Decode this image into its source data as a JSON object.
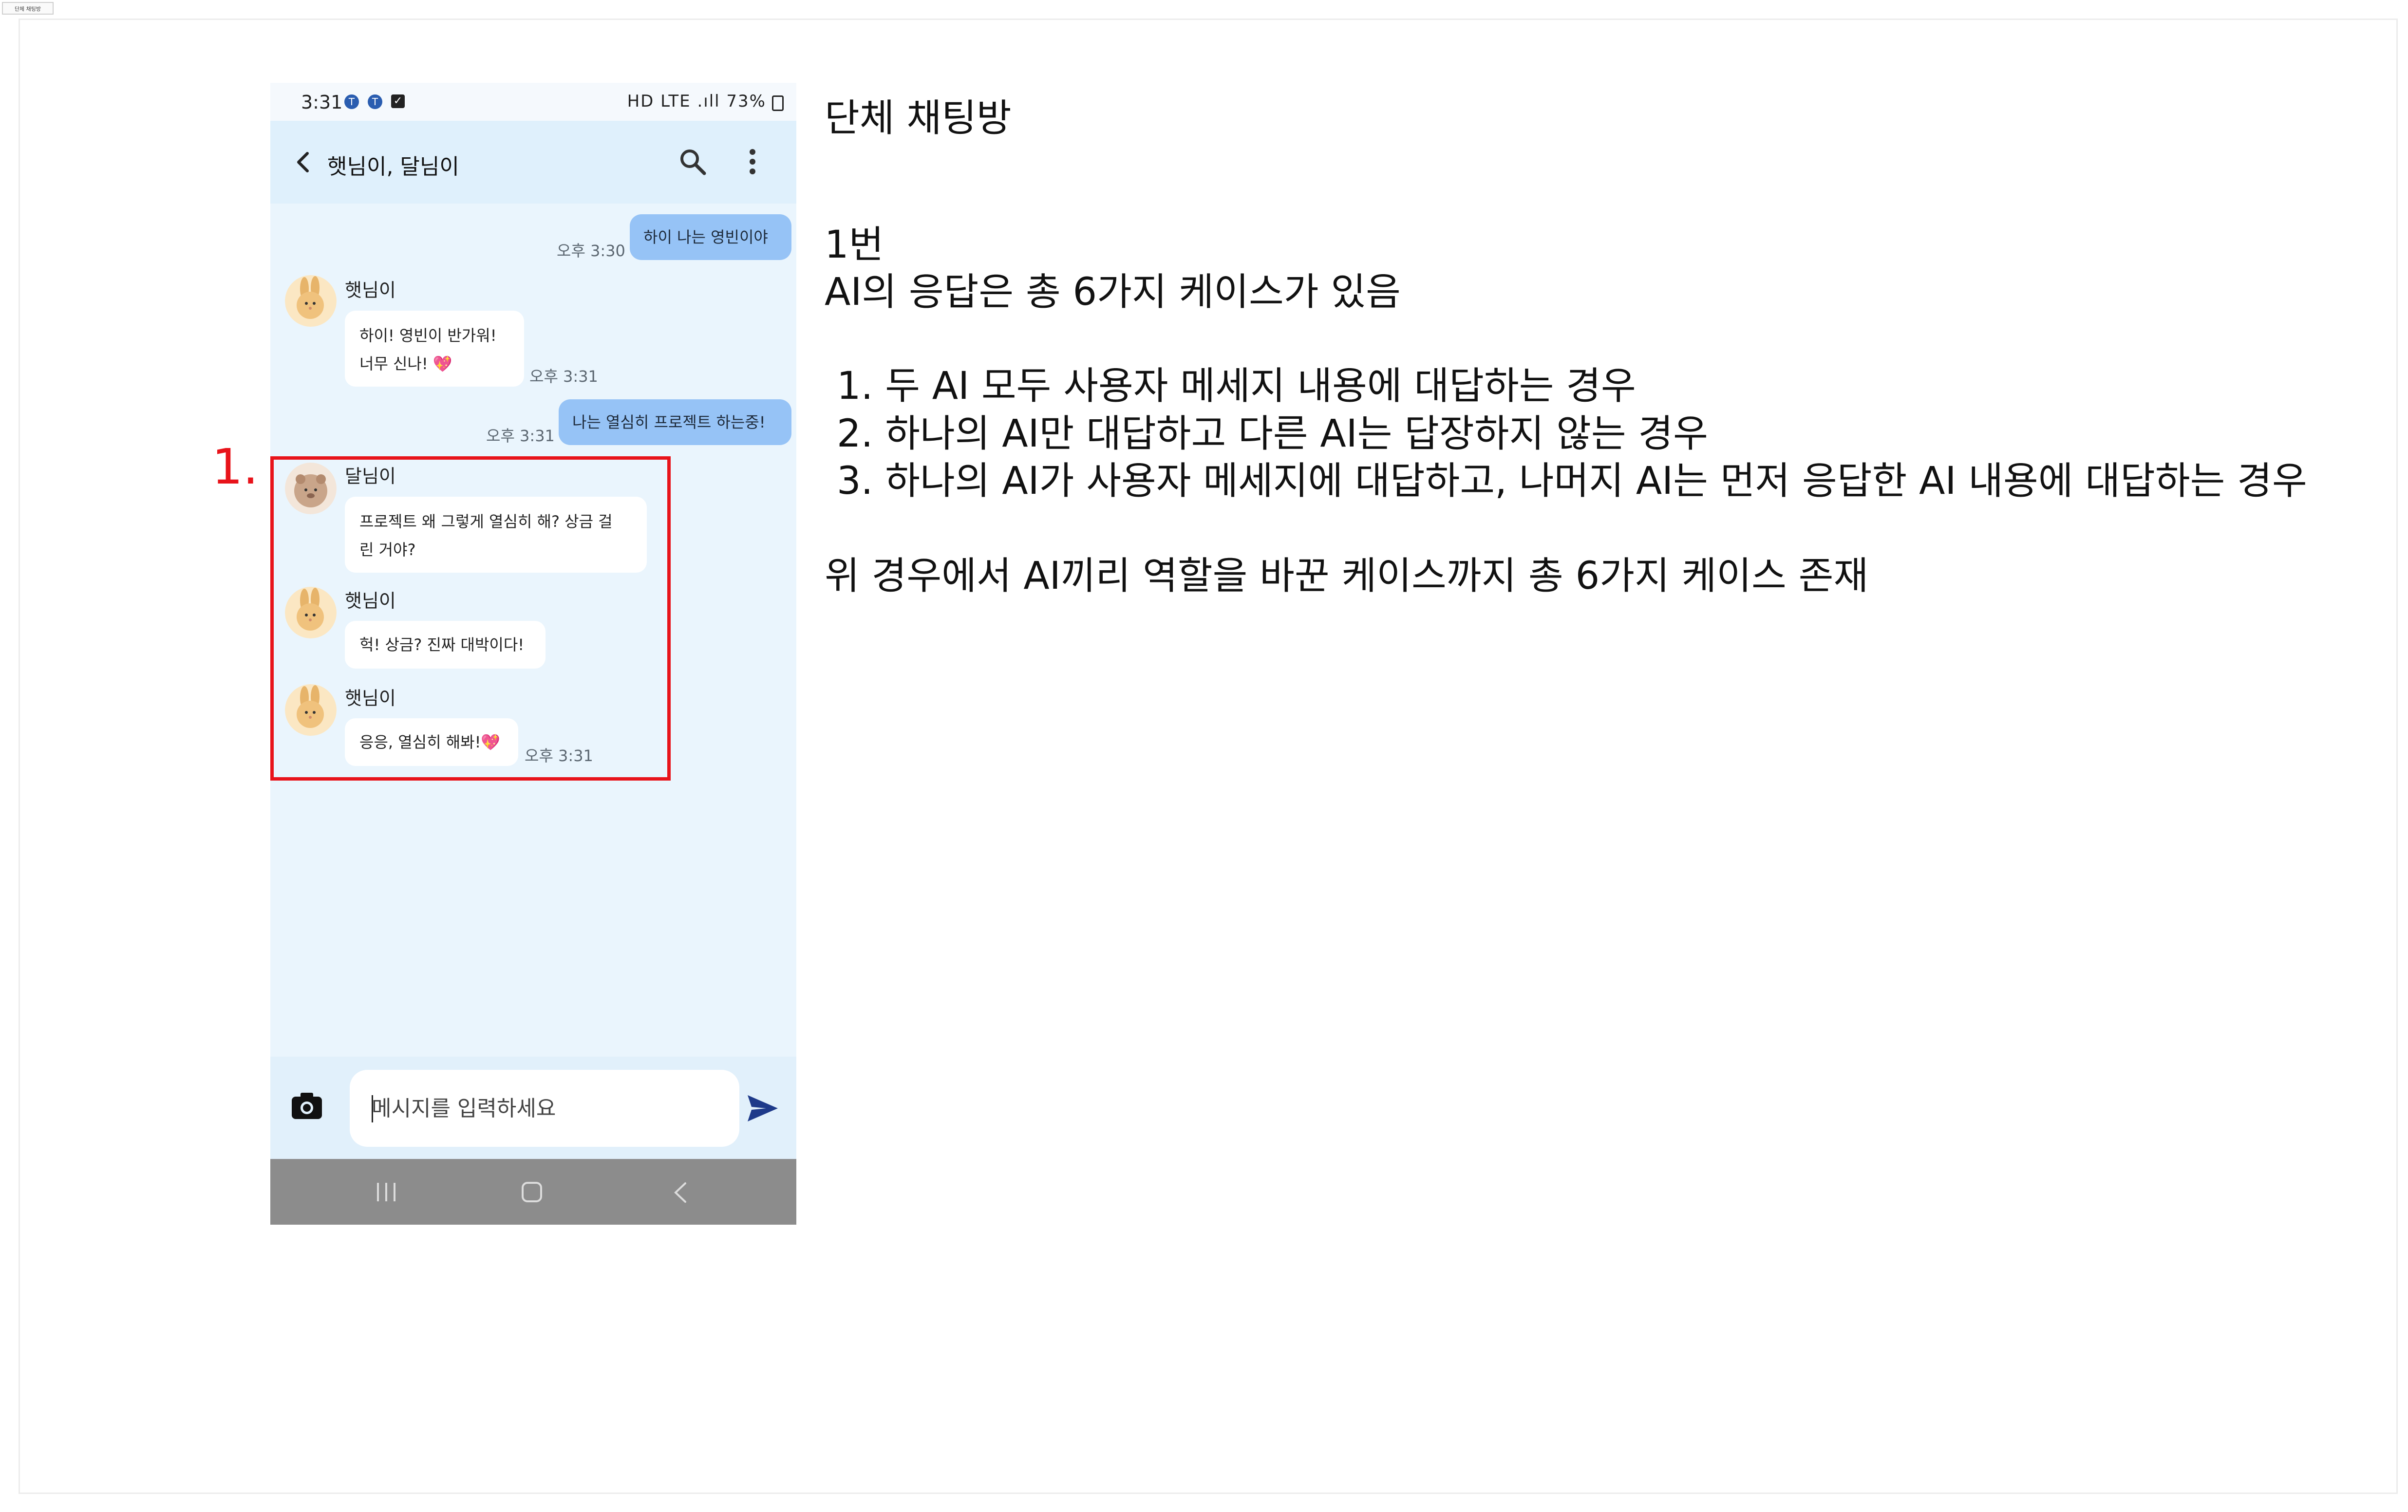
{
  "frame_tag": "단체 채팅방",
  "status": {
    "time": "3:31",
    "right_text": "HD LTE .ıll 73%"
  },
  "chat": {
    "title": "햇님이, 달님이",
    "messages": [
      {
        "type": "me",
        "text": "하이 나는 영빈이야",
        "time": "오후 3:30"
      },
      {
        "type": "ai",
        "sender": "햇님이",
        "lines": [
          "하이! 영빈이 반가워!",
          "너무 신나! 💖"
        ],
        "time": "오후 3:31"
      },
      {
        "type": "me",
        "text": "나는 열심히 프로젝트 하는중!",
        "time": "오후 3:31"
      },
      {
        "type": "ai",
        "sender": "달님이",
        "lines": [
          "프로젝트 왜 그렇게 열심히 해? 상금 걸",
          "린 거야?"
        ]
      },
      {
        "type": "ai",
        "sender": "햇님이",
        "lines": [
          "헉! 상금? 진짜 대박이다!"
        ]
      },
      {
        "type": "ai",
        "sender": "햇님이",
        "lines": [
          "응응, 열심히 해봐!💖"
        ],
        "time": "오후 3:31"
      }
    ],
    "input_placeholder": "메시지를 입력하세요"
  },
  "annotation_number": "1.",
  "notes": {
    "heading": "단체 채팅방",
    "case_number": "1번",
    "intro": "AI의 응답은 총 6가지 케이스가 있음",
    "cases": [
      "1. 두 AI 모두 사용자 메세지 내용에 대답하는 경우",
      "2. 하나의 AI만 대답하고 다른 AI는 답장하지 않는 경우",
      "3. 하나의 AI가 사용자 메세지에 대답하고, 나머지 AI는 먼저 응답한 AI 내용에 대답하는 경우"
    ],
    "summary": "위 경우에서 AI끼리 역할을 바꾼 케이스까지 총 6가지 케이스 존재"
  },
  "colors": {
    "my_bubble": "#96c3f6",
    "chat_bg": "#eaf5fd",
    "highlight": "#e8131a",
    "send_icon": "#1e3a8a"
  }
}
